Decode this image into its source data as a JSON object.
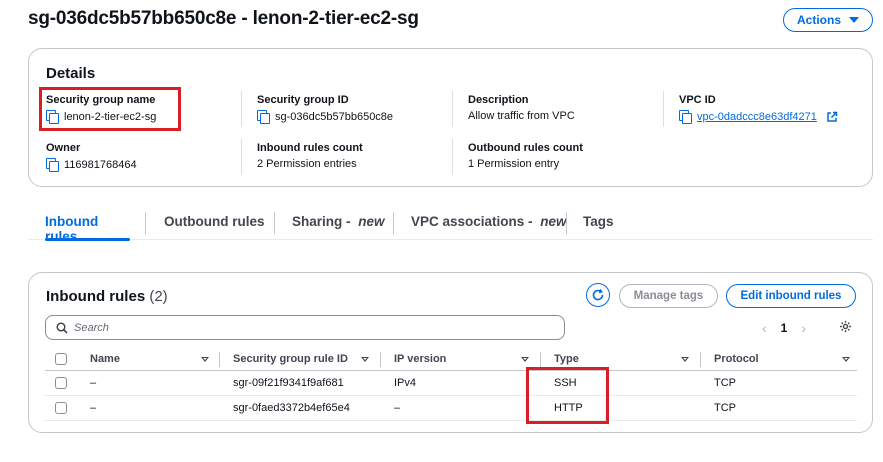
{
  "header": {
    "title": "sg-036dc5b57bb650c8e - lenon-2-tier-ec2-sg",
    "actions_label": "Actions"
  },
  "details": {
    "heading": "Details",
    "fields": {
      "sg_name": {
        "label": "Security group name",
        "value": "lenon-2-tier-ec2-sg"
      },
      "sg_id": {
        "label": "Security group ID",
        "value": "sg-036dc5b57bb650c8e"
      },
      "description": {
        "label": "Description",
        "value": "Allow traffic from VPC"
      },
      "vpc_id": {
        "label": "VPC ID",
        "value": "vpc-0dadccc8e63df4271"
      },
      "owner": {
        "label": "Owner",
        "value": "116981768464"
      },
      "inbound_count": {
        "label": "Inbound rules count",
        "value": "2 Permission entries"
      },
      "outbound_count": {
        "label": "Outbound rules count",
        "value": "1 Permission entry"
      }
    }
  },
  "tabs": [
    {
      "label": "Inbound rules",
      "suffix": ""
    },
    {
      "label": "Outbound rules",
      "suffix": ""
    },
    {
      "label": "Sharing - ",
      "suffix": "new"
    },
    {
      "label": "VPC associations - ",
      "suffix": "new"
    },
    {
      "label": "Tags",
      "suffix": ""
    }
  ],
  "inbound": {
    "title": "Inbound rules",
    "count": "(2)",
    "manage_tags_label": "Manage tags",
    "edit_label": "Edit inbound rules",
    "search_placeholder": "Search",
    "page": "1",
    "columns": [
      "Name",
      "Security group rule ID",
      "IP version",
      "Type",
      "Protocol"
    ],
    "rows": [
      {
        "name": "–",
        "rule_id": "sgr-09f21f9341f9af681",
        "ip_version": "IPv4",
        "type": "SSH",
        "protocol": "TCP"
      },
      {
        "name": "–",
        "rule_id": "sgr-0faed3372b4ef65e4",
        "ip_version": "–",
        "type": "HTTP",
        "protocol": "TCP"
      }
    ]
  },
  "colors": {
    "accent": "#006ce0",
    "highlight_box": "#d81f26"
  },
  "icons": [
    "copy-icon",
    "external-link-icon",
    "refresh-icon",
    "search-icon",
    "chevron-left-icon",
    "chevron-right-icon",
    "gear-icon",
    "caret-down-icon"
  ]
}
